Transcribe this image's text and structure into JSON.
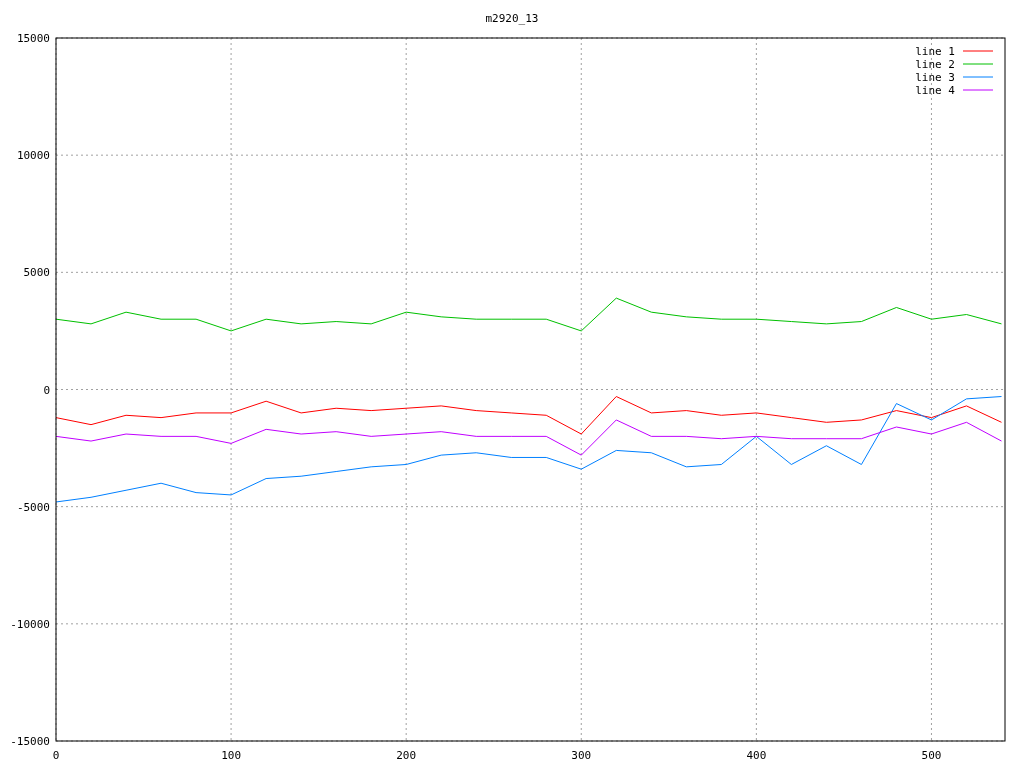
{
  "plot": {
    "chart_data": {
      "type": "line",
      "title": "m2920_13",
      "x": [
        0,
        20,
        40,
        60,
        80,
        100,
        120,
        140,
        160,
        180,
        200,
        220,
        240,
        260,
        280,
        300,
        320,
        340,
        360,
        380,
        400,
        420,
        440,
        460,
        480,
        500,
        520,
        540
      ],
      "series": [
        {
          "name": "line 1",
          "color": "#ff0000",
          "values": [
            -1200,
            -1500,
            -1100,
            -1200,
            -1000,
            -1000,
            -500,
            -1000,
            -800,
            -900,
            -800,
            -700,
            -900,
            -1000,
            -1100,
            -1900,
            -300,
            -1000,
            -900,
            -1100,
            -1000,
            -1200,
            -1400,
            -1300,
            -900,
            -1200,
            -700,
            -1400
          ]
        },
        {
          "name": "line 2",
          "color": "#00c000",
          "values": [
            3000,
            2800,
            3300,
            3000,
            3000,
            2500,
            3000,
            2800,
            2900,
            2800,
            3300,
            3100,
            3000,
            3000,
            3000,
            2500,
            3900,
            3300,
            3100,
            3000,
            3000,
            2900,
            2800,
            2900,
            3500,
            3000,
            3200,
            2800
          ]
        },
        {
          "name": "line 3",
          "color": "#0080ff",
          "values": [
            -4800,
            -4600,
            -4300,
            -4000,
            -4400,
            -4500,
            -3800,
            -3700,
            -3500,
            -3300,
            -3200,
            -2800,
            -2700,
            -2900,
            -2900,
            -3400,
            -2600,
            -2700,
            -3300,
            -3200,
            -2000,
            -3200,
            -2400,
            -3200,
            -600,
            -1300,
            -400,
            -300
          ]
        },
        {
          "name": "line 4",
          "color": "#c000ff",
          "values": [
            -2000,
            -2200,
            -1900,
            -2000,
            -2000,
            -2300,
            -1700,
            -1900,
            -1800,
            -2000,
            -1900,
            -1800,
            -2000,
            -2000,
            -2000,
            -2800,
            -1300,
            -2000,
            -2000,
            -2100,
            -2000,
            -2100,
            -2100,
            -2100,
            -1600,
            -1900,
            -1400,
            -2200
          ]
        }
      ],
      "xlim": [
        0,
        542
      ],
      "ylim": [
        -15000,
        15000
      ],
      "xticks": [
        0,
        100,
        200,
        300,
        400,
        500
      ],
      "yticks": [
        -15000,
        -10000,
        -5000,
        0,
        5000,
        10000,
        15000
      ],
      "grid": true,
      "legend": true
    }
  }
}
